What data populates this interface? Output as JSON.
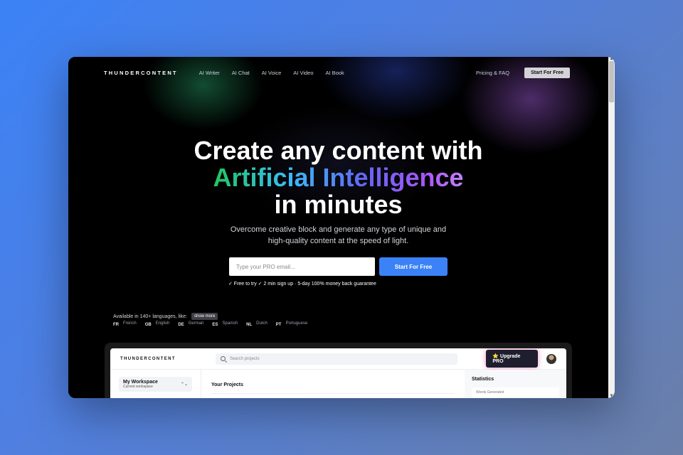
{
  "nav": {
    "logo": "THUNDERCONTENT",
    "links": [
      "AI Writer",
      "AI Chat",
      "AI Voice",
      "AI Video",
      "AI Book"
    ],
    "pricing": "Pricing & FAQ",
    "cta": "Start For Free"
  },
  "hero": {
    "line1": "Create any content with",
    "line2": "Artificial Intelligence",
    "line3": "in minutes",
    "sub1": "Overcome creative block and generate any type of unique and",
    "sub2": "high-quality content at the speed of light."
  },
  "signup": {
    "placeholder": "Type your PRO email...",
    "button": "Start For Free",
    "guarantee": "✓ Free to try ✓ 2 min sign up · 5-day 100% money back guarantee"
  },
  "languages": {
    "label": "Available in 140+ languages, like:",
    "show_more": "show more",
    "items": [
      {
        "code": "FR",
        "name": "French"
      },
      {
        "code": "GB",
        "name": "English"
      },
      {
        "code": "DE",
        "name": "German"
      },
      {
        "code": "ES",
        "name": "Spanish"
      },
      {
        "code": "NL",
        "name": "Dutch"
      },
      {
        "code": "PT",
        "name": "Portuguese"
      }
    ]
  },
  "preview": {
    "logo": "THUNDERCONTENT",
    "search_placeholder": "Search projects",
    "upgrade": "⭐ Upgrade PRO",
    "workspace_title": "My Workspace",
    "workspace_sub": "Current workspace",
    "projects_title": "Your Projects",
    "stats_title": "Statistics",
    "stats_card": "Words Generated"
  },
  "colors": {
    "accent": "#3b82f6",
    "gradient": [
      "#22c55e",
      "#38bdf8",
      "#6366f1",
      "#a855f7"
    ]
  }
}
